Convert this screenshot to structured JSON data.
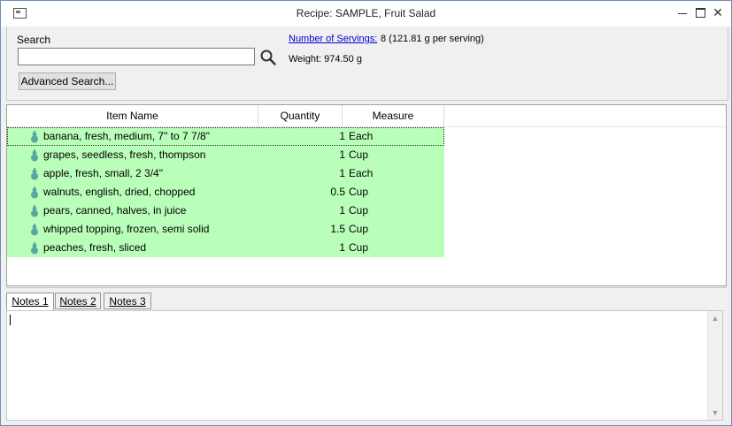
{
  "window": {
    "title": "Recipe: SAMPLE, Fruit Salad"
  },
  "search": {
    "label": "Search",
    "value": "",
    "advanced_button": "Advanced Search..."
  },
  "info": {
    "servings_link": "Number of Servings:",
    "servings_value": "8  (121.81 g per serving)",
    "weight": "Weight: 974.50 g"
  },
  "table": {
    "columns": [
      "Item Name",
      "Quantity",
      "Measure"
    ],
    "rows": [
      {
        "name": "banana, fresh, medium, 7\" to 7 7/8\"",
        "quantity": "1",
        "measure": "Each"
      },
      {
        "name": "grapes, seedless, fresh, thompson",
        "quantity": "1",
        "measure": "Cup"
      },
      {
        "name": "apple, fresh, small, 2 3/4\"",
        "quantity": "1",
        "measure": "Each"
      },
      {
        "name": "walnuts, english, dried, chopped",
        "quantity": "0.5",
        "measure": "Cup"
      },
      {
        "name": "pears, canned, halves, in juice",
        "quantity": "1",
        "measure": "Cup"
      },
      {
        "name": "whipped topping, frozen, semi solid",
        "quantity": "1.5",
        "measure": "Cup"
      },
      {
        "name": "peaches, fresh, sliced",
        "quantity": "1",
        "measure": "Cup"
      }
    ],
    "row_color": "#b9ffb9"
  },
  "notes": {
    "tabs": [
      "Notes 1",
      "Notes 2",
      "Notes 3"
    ],
    "active_tab": "Notes 1",
    "content": ""
  },
  "icons": {
    "app": "window-icon",
    "search": "magnifier-icon",
    "row": "food-item-icon"
  }
}
